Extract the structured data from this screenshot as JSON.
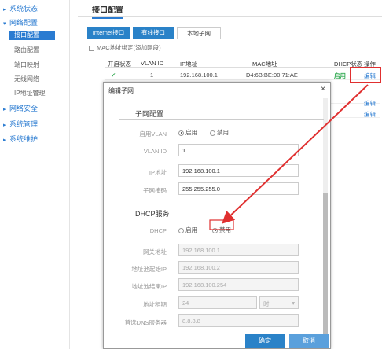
{
  "sidebar": {
    "groups": [
      {
        "label": "系统状态",
        "arrow": "▸"
      },
      {
        "label": "网络配置",
        "arrow": "▾"
      },
      {
        "label": "网络安全",
        "arrow": "▸"
      },
      {
        "label": "系统管理",
        "arrow": "▸"
      },
      {
        "label": "系统维护",
        "arrow": "▸"
      }
    ],
    "subitems": [
      "接口配置",
      "路由配置",
      "端口映射",
      "无线网络",
      "IP地址管理"
    ]
  },
  "page_title": "接口配置",
  "tabs": [
    "Internet接口",
    "有线接口",
    "本地子网"
  ],
  "add_row_label": "MAC地址绑定(添加网段)",
  "table": {
    "headers": [
      "开启状态",
      "VLAN ID",
      "IP地址",
      "MAC地址",
      "DHCP状态",
      "操作"
    ],
    "rows": [
      {
        "status": "✔",
        "vlan": "1",
        "ip": "192.168.100.1",
        "mac": "D4:6B:BE:00:71:AE",
        "dhcp": "启用",
        "action": "编辑"
      },
      {
        "status": "",
        "vlan": "",
        "ip": "",
        "mac": "",
        "dhcp": "",
        "action": "编辑"
      },
      {
        "status": "",
        "vlan": "",
        "ip": "",
        "mac": "",
        "dhcp": "",
        "action": "编辑"
      }
    ]
  },
  "modal": {
    "title": "编辑子网",
    "close": "×",
    "section1": "子网配置",
    "enable_vlan_label": "启用VLAN",
    "opt_on": "启用",
    "opt_off": "禁用",
    "vlan_id_label": "VLAN ID",
    "vlan_id_value": "1",
    "ip_label": "IP地址",
    "ip_value": "192.168.100.1",
    "mask_label": "子网掩码",
    "mask_value": "255.255.255.0",
    "section2": "DHCP服务",
    "dhcp_label": "DHCP",
    "dhcp_on": "启用",
    "dhcp_off": "禁用",
    "gateway_label": "网关地址",
    "gateway_value": "192.168.100.1",
    "start_label": "地址池起始IP",
    "start_value": "192.168.100.2",
    "end_label": "地址池结束IP",
    "end_value": "192.168.100.254",
    "lease_label": "地址租期",
    "lease_value": "24",
    "lease_unit": "时",
    "dns_label": "首选DNS服务器",
    "dns_value": "8.8.8.8",
    "ok_label": "确定",
    "cancel_label": "取消"
  },
  "colors": {
    "accent": "#2a82c8",
    "highlight": "#e03030"
  }
}
